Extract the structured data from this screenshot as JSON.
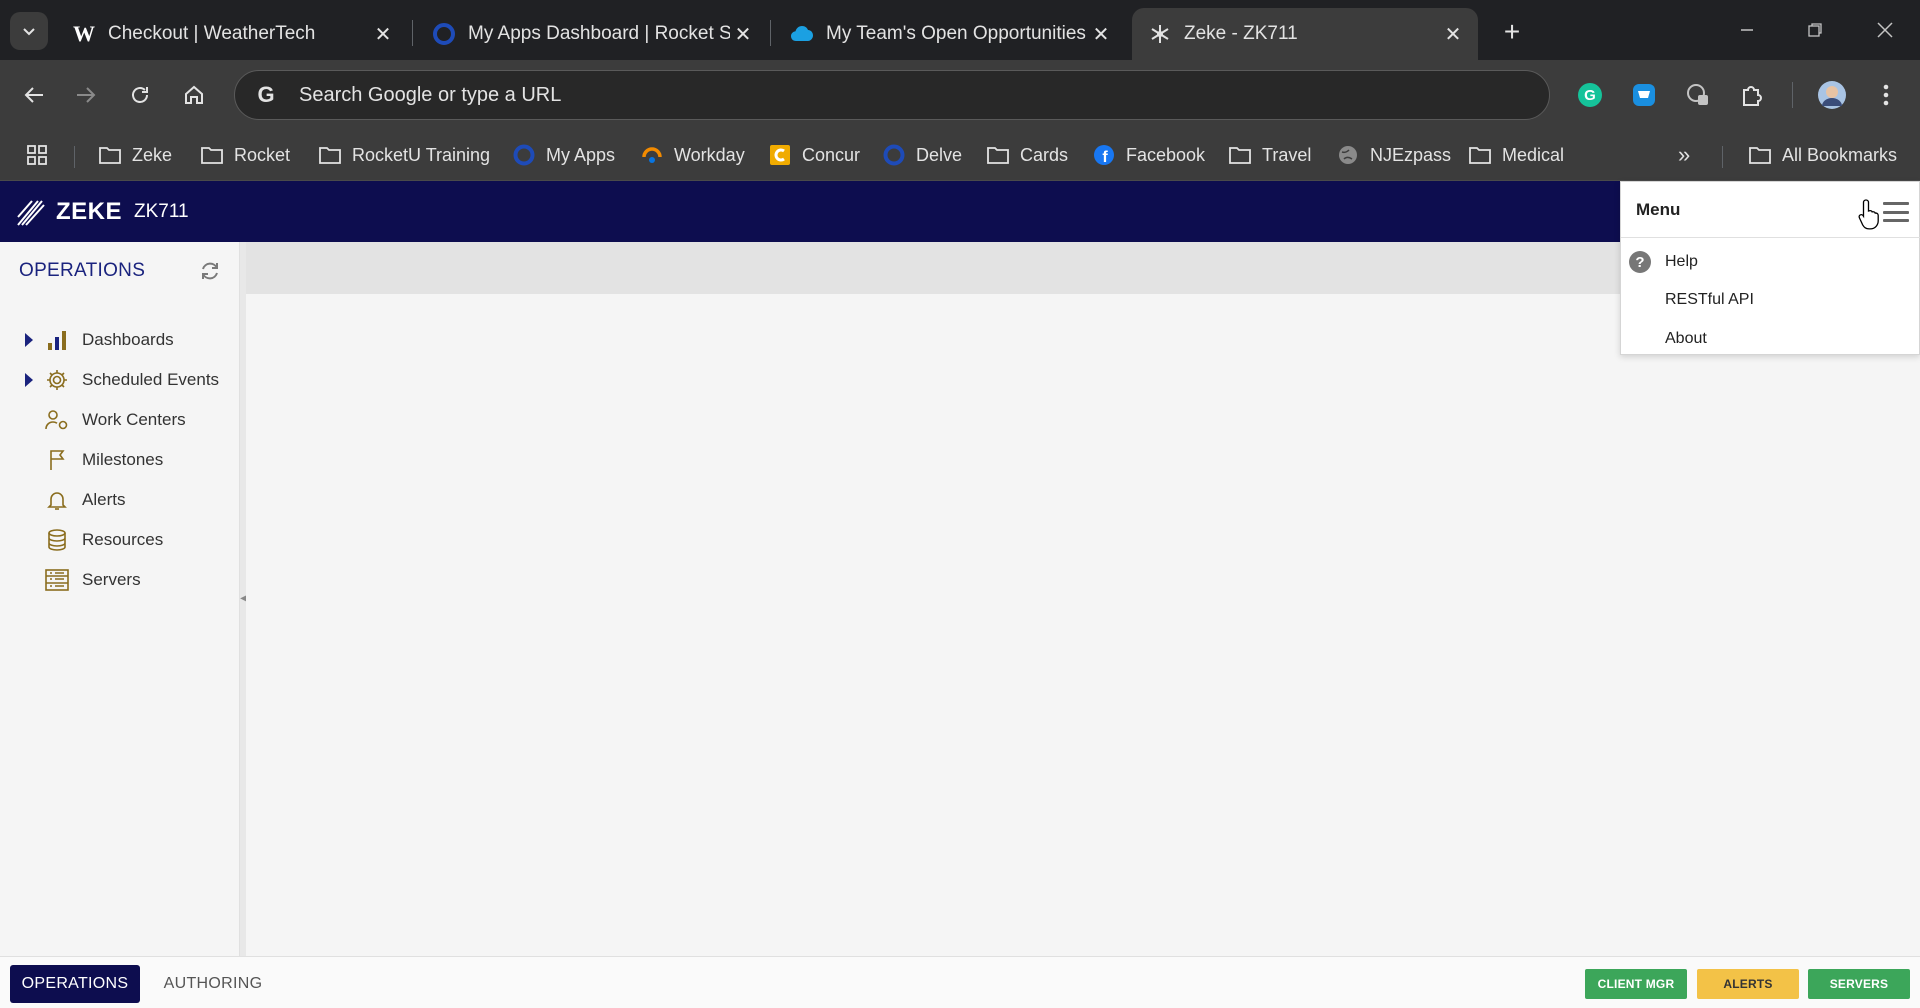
{
  "browser": {
    "tabs": [
      {
        "title": "Checkout | WeatherTech",
        "favicon": "weathertech-w-icon",
        "active": false
      },
      {
        "title": "My Apps Dashboard | Rocket Sc",
        "favicon": "rocket-circle-icon",
        "active": false
      },
      {
        "title": "My Team's Open Opportunities",
        "favicon": "salesforce-cloud-icon",
        "active": false
      },
      {
        "title": "Zeke - ZK711",
        "favicon": "zeke-star-icon",
        "active": true
      }
    ],
    "omnibox_placeholder": "Search Google or type a URL",
    "bookmarks": [
      {
        "label": "Zeke",
        "icon": "folder-icon"
      },
      {
        "label": "Rocket",
        "icon": "folder-icon"
      },
      {
        "label": "RocketU Training",
        "icon": "folder-icon"
      },
      {
        "label": "My Apps",
        "icon": "rocket-circle-icon"
      },
      {
        "label": "Workday",
        "icon": "workday-icon"
      },
      {
        "label": "Concur",
        "icon": "concur-icon"
      },
      {
        "label": "Delve",
        "icon": "delve-icon"
      },
      {
        "label": "Cards",
        "icon": "folder-icon"
      },
      {
        "label": "Facebook",
        "icon": "facebook-icon"
      },
      {
        "label": "Travel",
        "icon": "folder-icon"
      },
      {
        "label": "NJEzpass",
        "icon": "globe-icon"
      },
      {
        "label": "Medical",
        "icon": "folder-icon"
      }
    ],
    "all_bookmarks": "All Bookmarks"
  },
  "app": {
    "brand": "ZEKE",
    "instance": "ZK711",
    "colors": {
      "header": "#0d0d4f",
      "accent": "#1a237e",
      "client_mgr": "#3ca65a",
      "alerts": "#f3c247",
      "servers": "#3ca65a"
    }
  },
  "sidebar": {
    "title": "OPERATIONS",
    "items": [
      {
        "label": "Dashboards",
        "icon": "bar-chart-icon",
        "expandable": true
      },
      {
        "label": "Scheduled Events",
        "icon": "gear-icon",
        "expandable": true
      },
      {
        "label": "Work Centers",
        "icon": "people-gear-icon",
        "expandable": false
      },
      {
        "label": "Milestones",
        "icon": "flag-icon",
        "expandable": false
      },
      {
        "label": "Alerts",
        "icon": "bell-icon",
        "expandable": false
      },
      {
        "label": "Resources",
        "icon": "database-icon",
        "expandable": false
      },
      {
        "label": "Servers",
        "icon": "server-list-icon",
        "expandable": false
      }
    ]
  },
  "menu": {
    "title": "Menu",
    "items": [
      {
        "label": "Help",
        "icon": "question-circle-icon"
      },
      {
        "label": "RESTful API",
        "icon": ""
      },
      {
        "label": "About",
        "icon": ""
      }
    ]
  },
  "footer": {
    "tabs": [
      {
        "label": "OPERATIONS",
        "active": true
      },
      {
        "label": "AUTHORING",
        "active": false
      }
    ],
    "buttons": [
      {
        "label": "CLIENT MGR"
      },
      {
        "label": "ALERTS"
      },
      {
        "label": "SERVERS"
      }
    ]
  }
}
